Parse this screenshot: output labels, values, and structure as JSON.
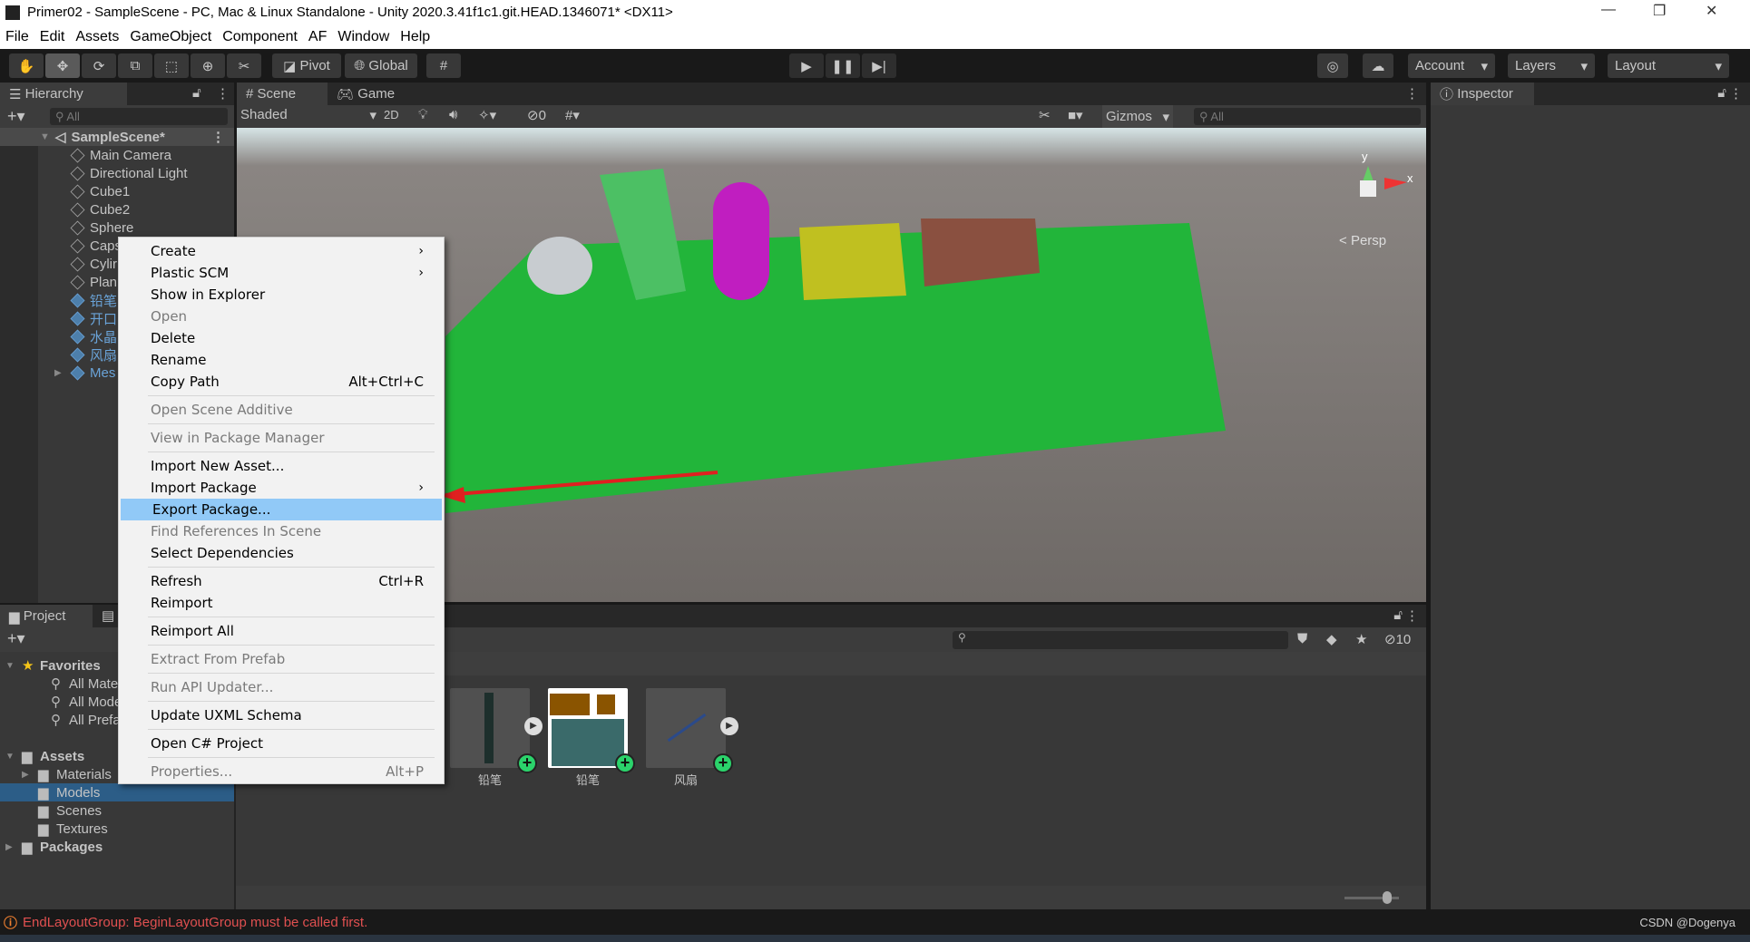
{
  "title": "Primer02 - SampleScene - PC, Mac & Linux Standalone - Unity 2020.3.41f1c1.git.HEAD.1346071* <DX11>",
  "menu": [
    "File",
    "Edit",
    "Assets",
    "GameObject",
    "Component",
    "AF",
    "Window",
    "Help"
  ],
  "toolbar": {
    "pivot": "Pivot",
    "global": "Global",
    "account": "Account",
    "layers": "Layers",
    "layout": "Layout"
  },
  "hierarchy": {
    "tab": "Hierarchy",
    "search_placeholder": "All",
    "scene": "SampleScene*",
    "items": [
      {
        "label": "Main Camera",
        "prefab": false
      },
      {
        "label": "Directional Light",
        "prefab": false
      },
      {
        "label": "Cube1",
        "prefab": false
      },
      {
        "label": "Cube2",
        "prefab": false
      },
      {
        "label": "Sphere",
        "prefab": false
      },
      {
        "label": "Caps",
        "prefab": false
      },
      {
        "label": "Cylir",
        "prefab": false
      },
      {
        "label": "Plan",
        "prefab": false
      },
      {
        "label": "铅笔",
        "prefab": true
      },
      {
        "label": "开口",
        "prefab": true
      },
      {
        "label": "水晶",
        "prefab": true
      },
      {
        "label": "风扇",
        "prefab": true
      },
      {
        "label": "Mes",
        "prefab": true
      }
    ]
  },
  "scene": {
    "tab_scene": "Scene",
    "tab_game": "Game",
    "shading": "Shaded",
    "mode2d": "2D",
    "hidden_count": "0",
    "gizmos": "Gizmos",
    "search_placeholder": "All",
    "persp": "Persp",
    "axis_y": "y",
    "axis_x": "x"
  },
  "inspector": {
    "tab": "Inspector"
  },
  "project": {
    "tab": "Project",
    "hidden_count": "10",
    "favorites": {
      "label": "Favorites",
      "items": [
        "All Materi",
        "All Models",
        "All Prefab"
      ]
    },
    "assets": {
      "label": "Assets",
      "items": [
        "Materials",
        "Models",
        "Scenes",
        "Textures"
      ],
      "selected": "Models"
    },
    "packages": "Packages",
    "grid": [
      {
        "label": "铅笔"
      },
      {
        "label": "铅笔"
      },
      {
        "label": "风扇"
      }
    ]
  },
  "context_menu": [
    {
      "label": "Create",
      "submenu": true
    },
    {
      "label": "Plastic SCM",
      "submenu": true
    },
    {
      "label": "Show in Explorer"
    },
    {
      "label": "Open",
      "disabled": true
    },
    {
      "label": "Delete"
    },
    {
      "label": "Rename"
    },
    {
      "label": "Copy Path",
      "shortcut": "Alt+Ctrl+C",
      "sep": true
    },
    {
      "label": "Open Scene Additive",
      "disabled": true,
      "sep": true
    },
    {
      "label": "View in Package Manager",
      "disabled": true,
      "sep": true
    },
    {
      "label": "Import New Asset..."
    },
    {
      "label": "Import Package",
      "submenu": true
    },
    {
      "label": "Export Package...",
      "highlighted": true
    },
    {
      "label": "Find References In Scene",
      "disabled": true
    },
    {
      "label": "Select Dependencies",
      "sep": true
    },
    {
      "label": "Refresh",
      "shortcut": "Ctrl+R"
    },
    {
      "label": "Reimport",
      "sep": true
    },
    {
      "label": "Reimport All",
      "sep": true
    },
    {
      "label": "Extract From Prefab",
      "disabled": true,
      "sep": true
    },
    {
      "label": "Run API Updater...",
      "disabled": true,
      "sep": true
    },
    {
      "label": "Update UXML Schema",
      "sep": true
    },
    {
      "label": "Open C# Project",
      "sep": true
    },
    {
      "label": "Properties...",
      "disabled": true,
      "shortcut": "Alt+P"
    }
  ],
  "status": {
    "message": "EndLayoutGroup: BeginLayoutGroup must be called first.",
    "watermark": "CSDN @Dogenya"
  },
  "colors": {
    "highlight": "#91c9f7",
    "error": "#e05050",
    "plane": "#22b53a",
    "arrow": "#e02020"
  }
}
